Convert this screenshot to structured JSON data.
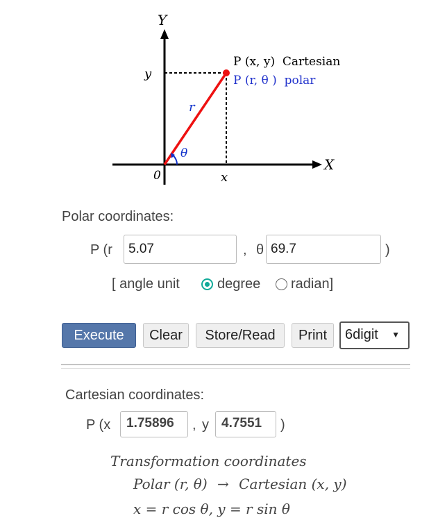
{
  "diagram": {
    "axis_y_label": "Y",
    "axis_x_label": "X",
    "origin_label": "0",
    "y_tick_label": "y",
    "x_tick_label": "x",
    "r_label": "r",
    "theta_label": "θ",
    "point_cartesian_label": "P (x, y)  Cartesian",
    "point_polar_label": "P (r, θ )  polar",
    "line_color": "#ee1111",
    "polar_label_color": "#2233cc"
  },
  "polar": {
    "heading": "Polar coordinates:",
    "prefix": "P (r",
    "r_value": "5.07",
    "separator": ",",
    "theta_prefix": "θ",
    "theta_value": "69.7",
    "suffix": ")",
    "angle_unit_open": "[ angle unit",
    "option_degree": "degree",
    "option_radian": "radian]",
    "selected_unit": "degree"
  },
  "toolbar": {
    "execute_label": "Execute",
    "clear_label": "Clear",
    "store_read_label": "Store/Read",
    "print_label": "Print",
    "digits_value": "6digit",
    "accent_color": "#5577aa"
  },
  "cartesian": {
    "heading": "Cartesian coordinates:",
    "prefix": "P (x",
    "x_value": "1.75896",
    "separator": ",",
    "y_prefix": "y",
    "y_value": "4.7551",
    "suffix": ")"
  },
  "info": {
    "title": "Transformation coordinates",
    "line1_polar": "Polar (r, θ)",
    "arrow": "→",
    "line1_cartesian": "Cartesian (x, y)",
    "line2": "x = r cos θ, y = r sin θ"
  }
}
